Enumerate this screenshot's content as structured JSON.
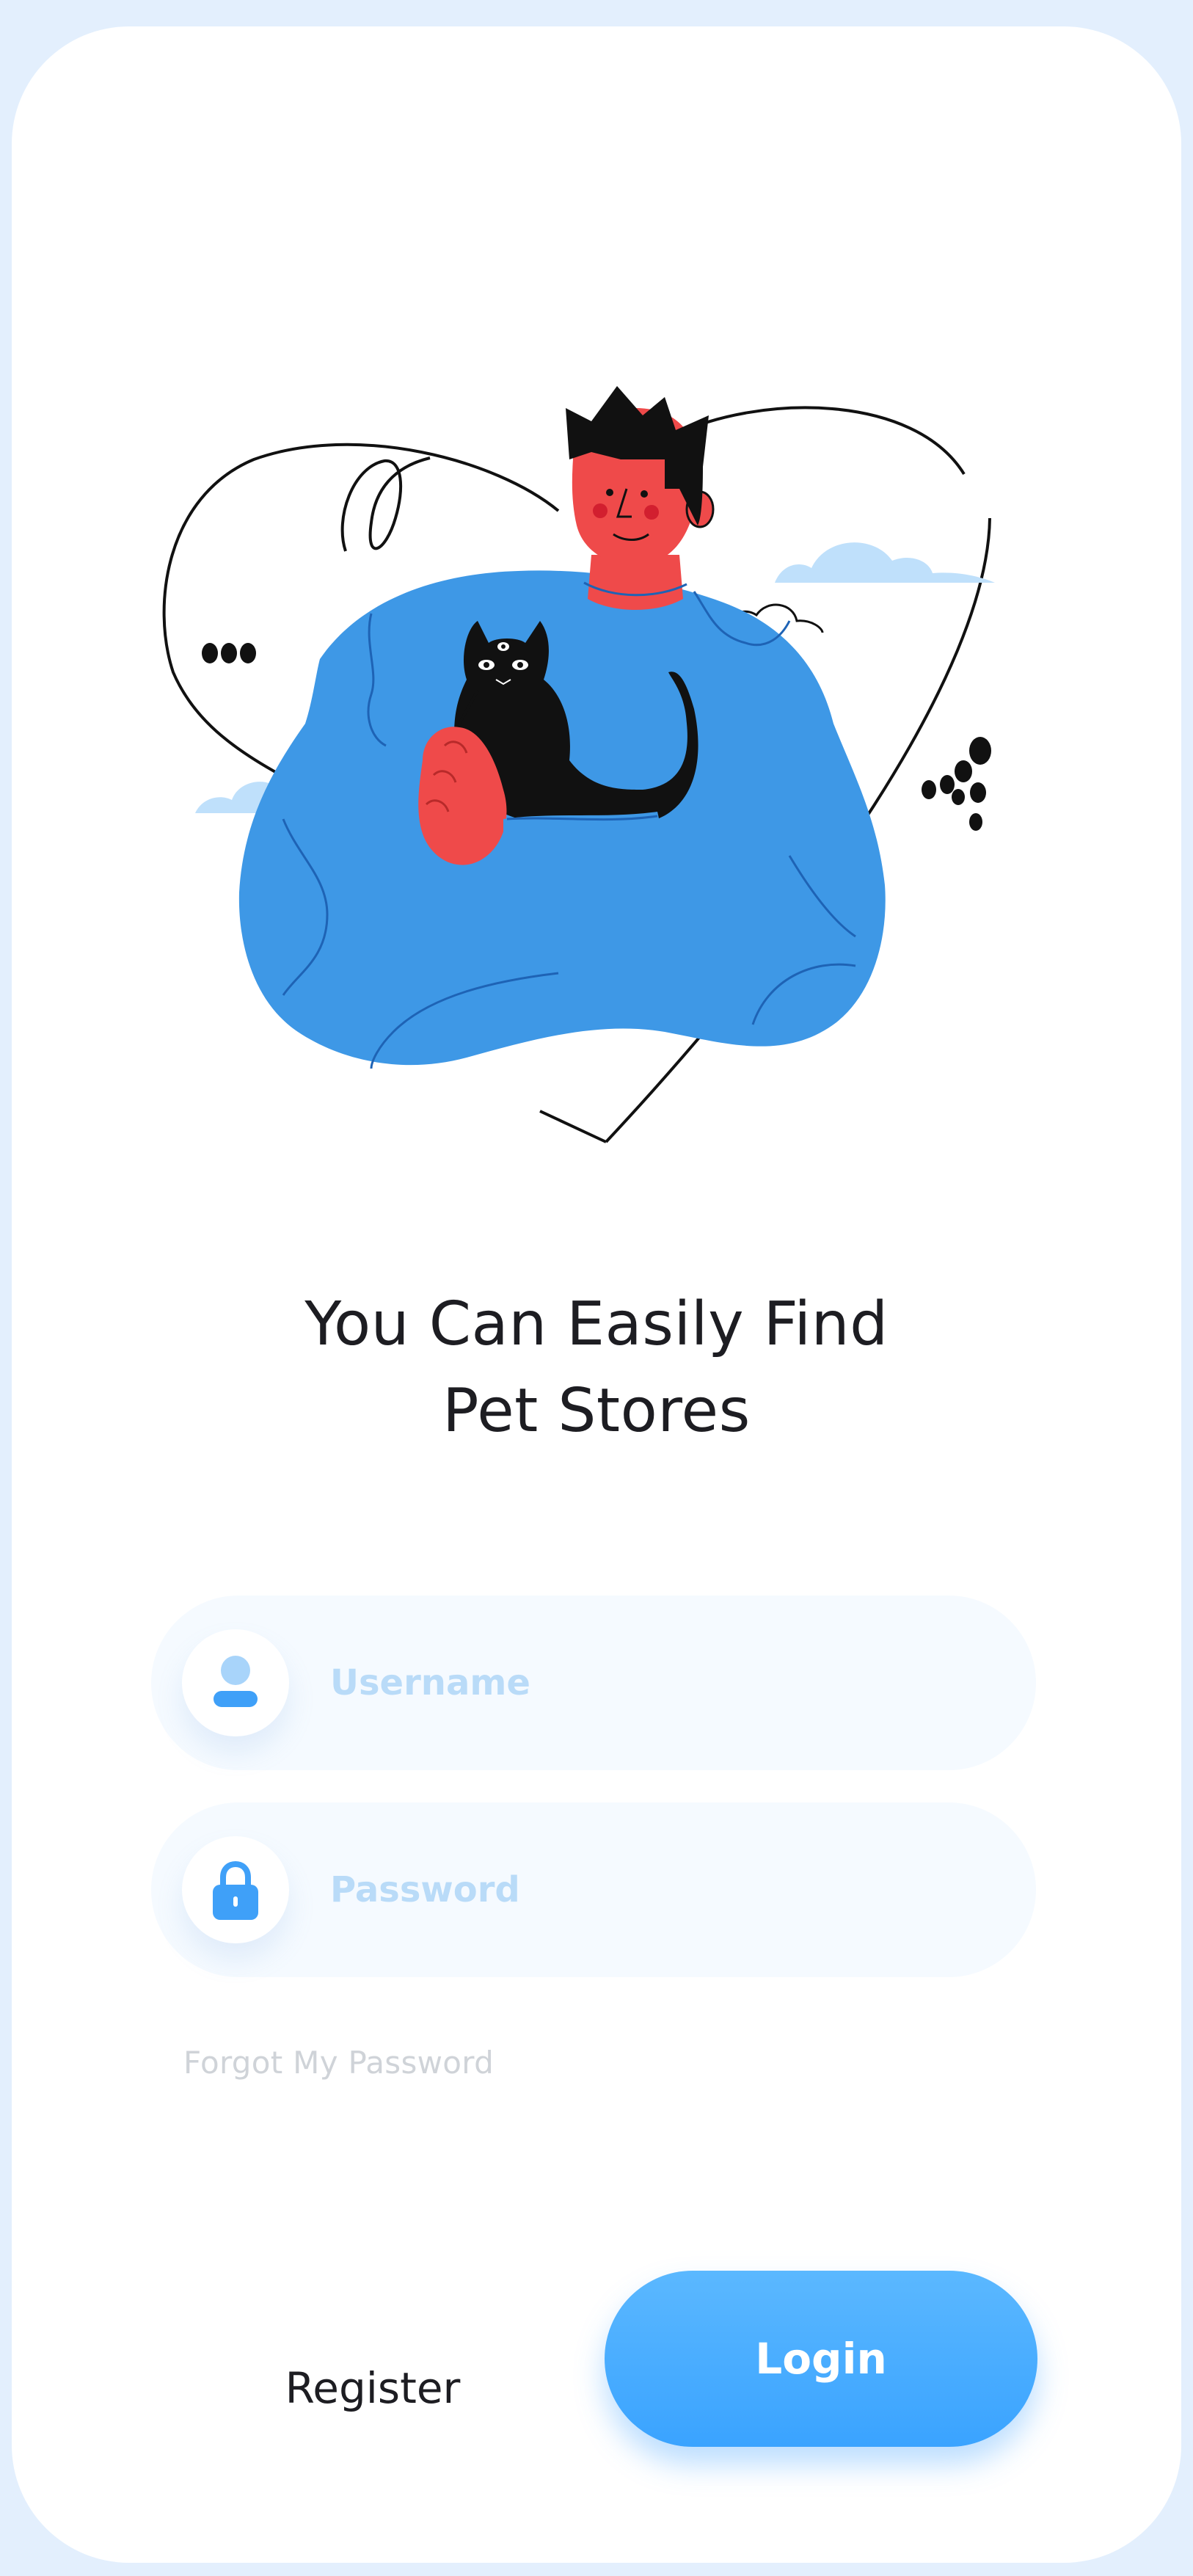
{
  "title": {
    "line1": "You Can Easily Find",
    "line2": "Pet Stores"
  },
  "fields": {
    "username": {
      "placeholder": "Username",
      "value": "",
      "icon": "user-icon"
    },
    "password": {
      "placeholder": "Password",
      "value": "",
      "icon": "lock-icon"
    }
  },
  "forgot_password_label": "Forgot My Password",
  "actions": {
    "register_label": "Register",
    "login_label": "Login"
  },
  "illustration": {
    "subject": "person-hugging-cat-with-heart"
  },
  "colors": {
    "background": "#e3effd",
    "card": "#ffffff",
    "accent": "#3aa3ff",
    "field_background": "#f5faff",
    "placeholder": "#b9dbf8",
    "title_text": "#1d1d22",
    "sweater": "#3e98e6",
    "skin": "#ef4a4a"
  }
}
